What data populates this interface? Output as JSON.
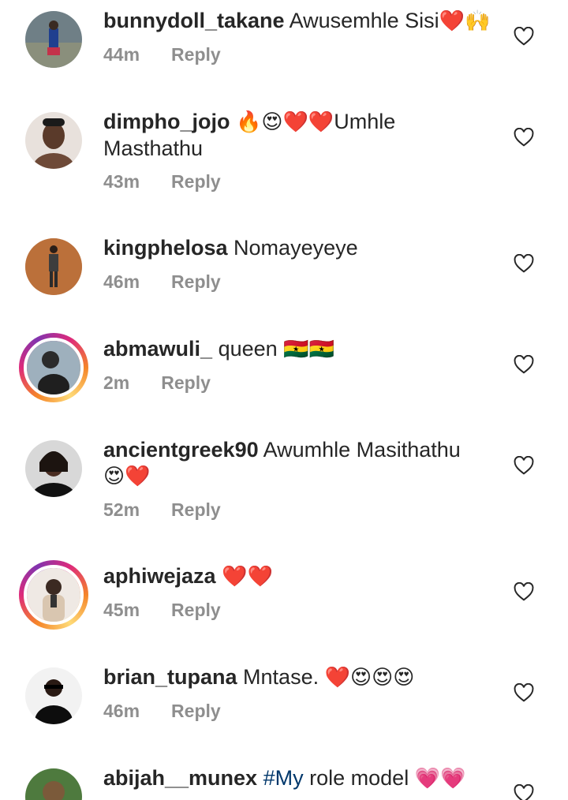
{
  "comments": [
    {
      "username": "bunnydoll_takane",
      "text": "Awusemhle Sisi",
      "emoji": "❤️🙌",
      "time": "44m",
      "reply": "Reply",
      "avatar": "avatar",
      "has_story": false
    },
    {
      "username": "dimpho_jojo",
      "text": "Umhle",
      "emoji_before": "🔥😍❤️❤️",
      "text2": "Masthathu",
      "time": "43m",
      "reply": "Reply",
      "has_story": false
    },
    {
      "username": "kingphelosa",
      "text": "Nomayeyeye",
      "time": "46m",
      "reply": "Reply",
      "has_story": false
    },
    {
      "username": "abmawuli_",
      "text": "queen",
      "emoji": "🇬🇭🇬🇭",
      "time": "2m",
      "reply": "Reply",
      "has_story": true
    },
    {
      "username": "ancientgreek90",
      "text": "Awumhle Masithathu",
      "emoji_line2": "😍❤️",
      "time": "52m",
      "reply": "Reply",
      "has_story": false
    },
    {
      "username": "aphiwejaza",
      "emoji": "❤️❤️",
      "time": "45m",
      "reply": "Reply",
      "has_story": true
    },
    {
      "username": "brian_tupana",
      "text": "Mntase.",
      "emoji": "❤️😍😍😍",
      "time": "46m",
      "reply": "Reply",
      "has_story": false
    },
    {
      "username": "abijah__munex",
      "hashtag": "#My",
      "text": "role model",
      "emoji": "💗💗",
      "has_story": false
    }
  ],
  "icons": {
    "like": "heart-outline-icon"
  },
  "colors": {
    "text": "#262626",
    "meta": "#8e8e8e",
    "hashtag": "#00376b"
  }
}
